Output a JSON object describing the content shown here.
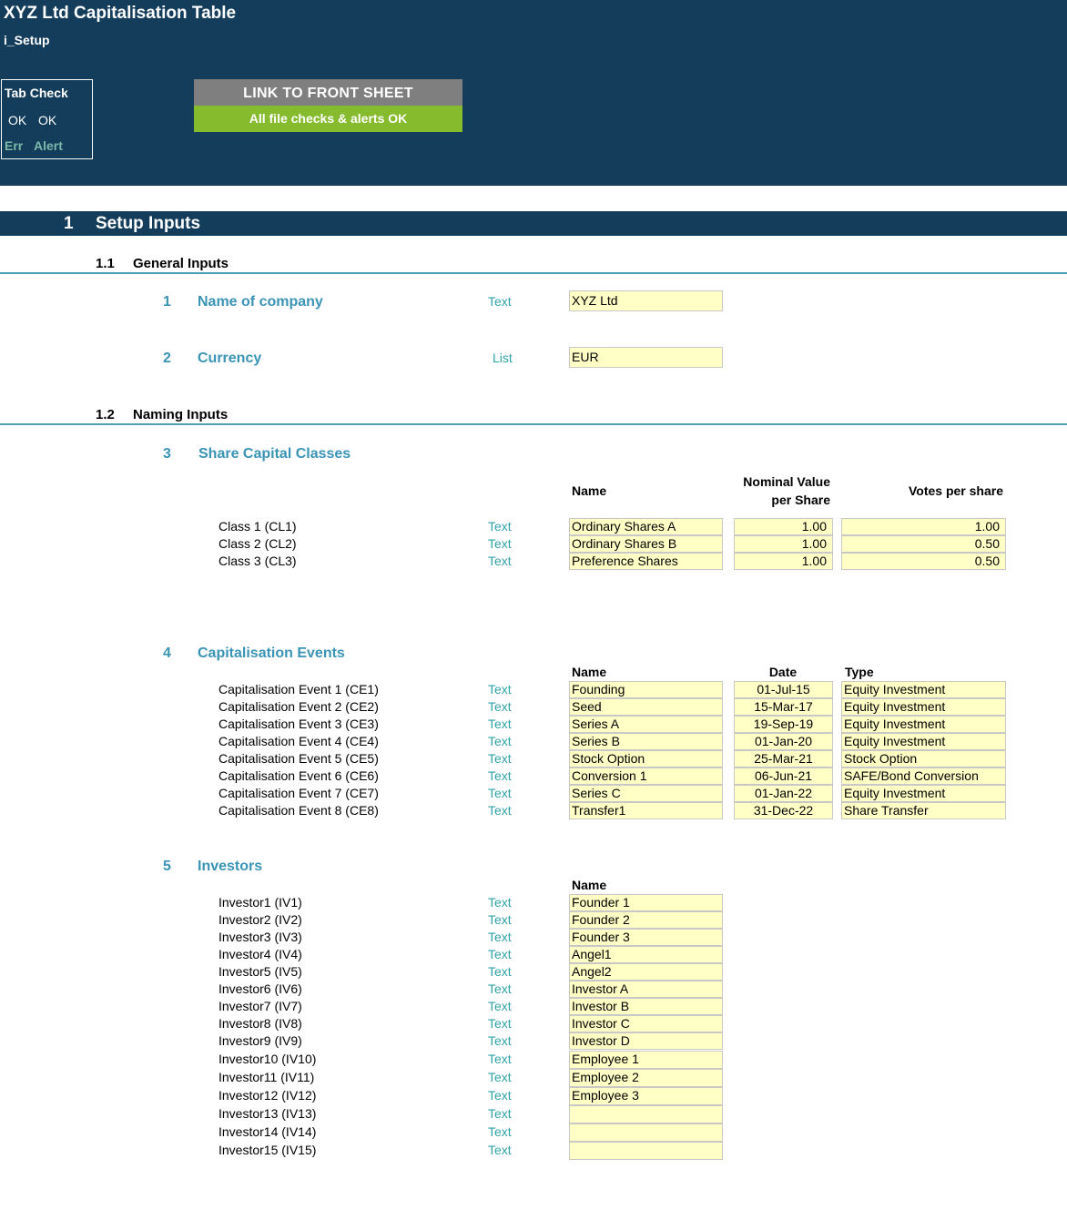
{
  "header": {
    "title": "XYZ Ltd Capitalisation Table",
    "sheet": "i_Setup",
    "tab_check": {
      "title": "Tab Check",
      "ok1": "OK",
      "ok2": "OK",
      "err": "Err",
      "alert": "Alert"
    },
    "link_button": "LINK TO FRONT SHEET",
    "status": "All file checks & alerts OK"
  },
  "section": {
    "number": "1",
    "label": "Setup Inputs"
  },
  "general": {
    "number": "1.1",
    "label": "General Inputs",
    "items": [
      {
        "num": "1",
        "label": "Name of company",
        "type": "Text",
        "value": "XYZ Ltd"
      },
      {
        "num": "2",
        "label": "Currency",
        "type": "List",
        "value": "EUR"
      }
    ]
  },
  "naming": {
    "number": "1.2",
    "label": "Naming Inputs"
  },
  "share_classes": {
    "num": "3",
    "label": "Share Capital Classes",
    "headers": {
      "name": "Name",
      "nominal_1": "Nominal Value",
      "nominal_2": "per Share",
      "votes": "Votes per share"
    },
    "rows": [
      {
        "label": "Class 1 (CL1)",
        "type": "Text",
        "name": "Ordinary Shares A",
        "nominal": "1.00",
        "votes": "1.00"
      },
      {
        "label": "Class 2 (CL2)",
        "type": "Text",
        "name": "Ordinary Shares B",
        "nominal": "1.00",
        "votes": "0.50"
      },
      {
        "label": "Class 3 (CL3)",
        "type": "Text",
        "name": "Preference Shares",
        "nominal": "1.00",
        "votes": "0.50"
      }
    ]
  },
  "cap_events": {
    "num": "4",
    "label": "Capitalisation Events",
    "headers": {
      "name": "Name",
      "date": "Date",
      "type": "Type"
    },
    "rows": [
      {
        "label": "Capitalisation Event 1 (CE1)",
        "type": "Text",
        "name": "Founding",
        "date": "01-Jul-15",
        "event_type": "Equity Investment"
      },
      {
        "label": "Capitalisation Event 2 (CE2)",
        "type": "Text",
        "name": "Seed",
        "date": "15-Mar-17",
        "event_type": "Equity Investment"
      },
      {
        "label": "Capitalisation Event 3 (CE3)",
        "type": "Text",
        "name": "Series A",
        "date": "19-Sep-19",
        "event_type": "Equity Investment"
      },
      {
        "label": "Capitalisation Event 4 (CE4)",
        "type": "Text",
        "name": "Series B",
        "date": "01-Jan-20",
        "event_type": "Equity Investment"
      },
      {
        "label": "Capitalisation Event 5 (CE5)",
        "type": "Text",
        "name": "Stock Option",
        "date": "25-Mar-21",
        "event_type": "Stock Option"
      },
      {
        "label": "Capitalisation Event 6 (CE6)",
        "type": "Text",
        "name": "Conversion 1",
        "date": "06-Jun-21",
        "event_type": "SAFE/Bond Conversion"
      },
      {
        "label": "Capitalisation Event 7 (CE7)",
        "type": "Text",
        "name": "Series C",
        "date": "01-Jan-22",
        "event_type": "Equity Investment"
      },
      {
        "label": "Capitalisation Event 8 (CE8)",
        "type": "Text",
        "name": "Transfer1",
        "date": "31-Dec-22",
        "event_type": "Share Transfer"
      }
    ]
  },
  "investors": {
    "num": "5",
    "label": "Investors",
    "headers": {
      "name": "Name"
    },
    "rows": [
      {
        "label": "Investor1 (IV1)",
        "type": "Text",
        "name": "Founder 1"
      },
      {
        "label": "Investor2 (IV2)",
        "type": "Text",
        "name": "Founder 2"
      },
      {
        "label": "Investor3 (IV3)",
        "type": "Text",
        "name": "Founder 3"
      },
      {
        "label": "Investor4 (IV4)",
        "type": "Text",
        "name": "Angel1"
      },
      {
        "label": "Investor5 (IV5)",
        "type": "Text",
        "name": "Angel2"
      },
      {
        "label": "Investor6 (IV6)",
        "type": "Text",
        "name": "Investor A"
      },
      {
        "label": "Investor7 (IV7)",
        "type": "Text",
        "name": "Investor B"
      },
      {
        "label": "Investor8 (IV8)",
        "type": "Text",
        "name": "Investor C"
      },
      {
        "label": "Investor9 (IV9)",
        "type": "Text",
        "name": "Investor D"
      },
      {
        "label": "Investor10 (IV10)",
        "type": "Text",
        "name": "Employee 1"
      },
      {
        "label": "Investor11 (IV11)",
        "type": "Text",
        "name": "Employee 2"
      },
      {
        "label": "Investor12 (IV12)",
        "type": "Text",
        "name": "Employee 3"
      },
      {
        "label": "Investor13 (IV13)",
        "type": "Text",
        "name": ""
      },
      {
        "label": "Investor14 (IV14)",
        "type": "Text",
        "name": ""
      },
      {
        "label": "Investor15 (IV15)",
        "type": "Text",
        "name": ""
      }
    ]
  }
}
